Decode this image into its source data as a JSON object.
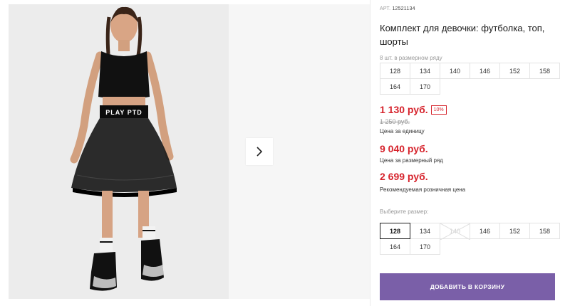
{
  "gallery": {
    "shirt_print": "PLAY PTD"
  },
  "product": {
    "art_label": "АРТ.",
    "art_number": "12521134",
    "title": "Комплект для девочки: футболка, топ, шорты"
  },
  "size_range": {
    "caption": "8 шт. в размерном ряду",
    "sizes": [
      "128",
      "134",
      "140",
      "146",
      "152",
      "158",
      "164",
      "170"
    ]
  },
  "pricing": {
    "unit_price": "1 130 руб.",
    "discount_badge": "10%",
    "old_price": "1 250 руб.",
    "unit_caption": "Цена за единицу",
    "range_price": "9 040 руб.",
    "range_caption": "Цена за размерный ряд",
    "retail_price": "2 699 руб.",
    "retail_caption": "Рекомендуемая розничная цена",
    "accent_color": "#d6232c"
  },
  "size_picker": {
    "caption": "Выберите размер:",
    "sizes": [
      "128",
      "134",
      "140",
      "146",
      "152",
      "158",
      "164",
      "170"
    ],
    "selected": "128",
    "unavailable": "140"
  },
  "cart": {
    "button_label": "ДОБАВИТЬ В КОРЗИНУ",
    "button_color": "#7a5fa8"
  },
  "icons": {
    "next": "chevron-right-icon"
  }
}
